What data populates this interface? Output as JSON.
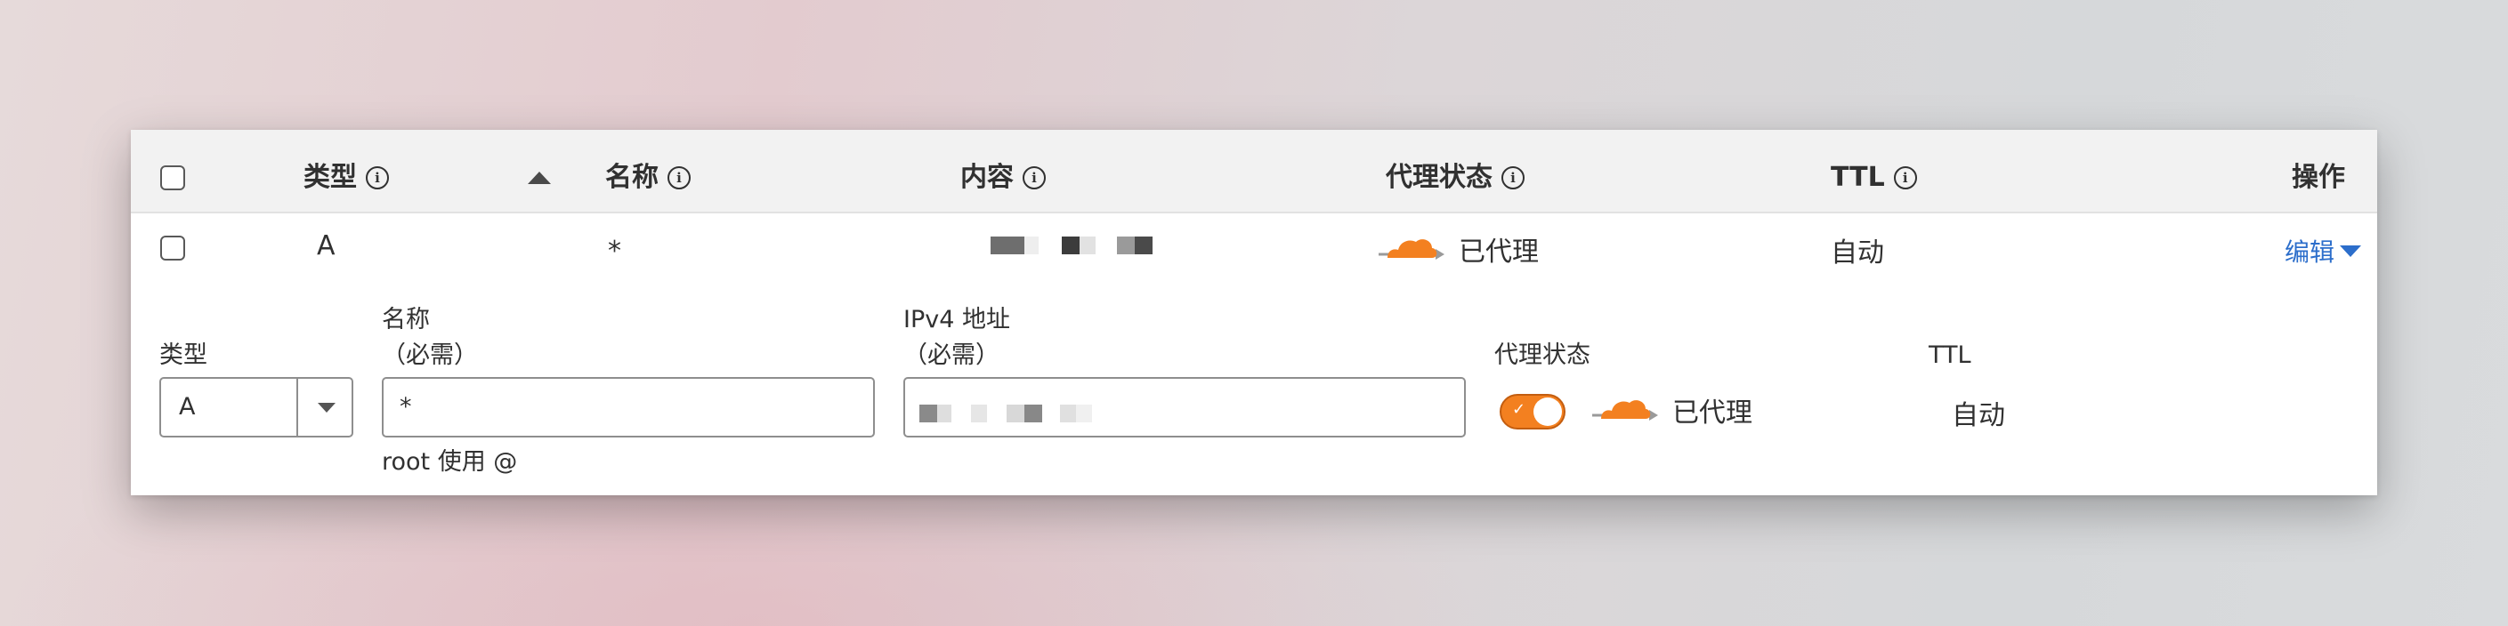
{
  "table": {
    "headers": {
      "type": "类型",
      "name": "名称",
      "content": "内容",
      "proxy_status": "代理状态",
      "ttl": "TTL",
      "actions": "操作"
    },
    "row": {
      "type": "A",
      "name": "*",
      "proxy_status": "已代理",
      "ttl": "自动",
      "edit": "编辑"
    }
  },
  "form": {
    "type_label": "类型",
    "type_value": "A",
    "name_label": "名称",
    "name_required": "（必需）",
    "name_value": "*",
    "name_hint": "root 使用 @",
    "ipv4_label": "IPv4 地址",
    "ipv4_required": "（必需）",
    "proxy_label": "代理状态",
    "proxy_value": "已代理",
    "proxy_enabled": true,
    "ttl_label": "TTL",
    "ttl_value": "自动"
  },
  "colors": {
    "accent_orange": "#f38020",
    "link_blue": "#2c6ecb"
  },
  "icons": [
    "info-icon",
    "sort-ascending-icon",
    "cloud-proxied-icon",
    "caret-down-icon",
    "checkmark-icon"
  ]
}
